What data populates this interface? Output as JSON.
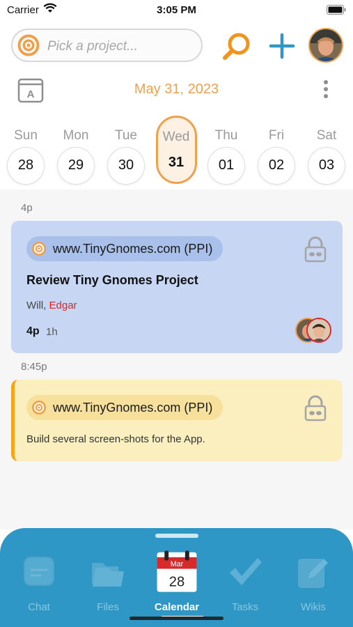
{
  "status_bar": {
    "carrier": "Carrier",
    "time": "3:05 PM"
  },
  "header": {
    "project_placeholder": "Pick a project...",
    "current_date": "May 31, 2023",
    "calendar_format_icon_letter": "A"
  },
  "week": [
    {
      "day": "Sun",
      "date": "28",
      "selected": false
    },
    {
      "day": "Mon",
      "date": "29",
      "selected": false
    },
    {
      "day": "Tue",
      "date": "30",
      "selected": false
    },
    {
      "day": "Wed",
      "date": "31",
      "selected": true
    },
    {
      "day": "Thu",
      "date": "01",
      "selected": false
    },
    {
      "day": "Fri",
      "date": "02",
      "selected": false
    },
    {
      "day": "Sat",
      "date": "03",
      "selected": false
    }
  ],
  "schedule": {
    "groups": [
      {
        "time": "4p",
        "event": {
          "project": "www.TinyGnomes.com (PPI)",
          "title": "Review Tiny Gnomes Project",
          "attendee_first": "Will,",
          "attendee_second": "Edgar",
          "start": "4p",
          "duration": "1h",
          "color": "#c6d6f3"
        }
      },
      {
        "time": "8:45p",
        "event": {
          "project": "www.TinyGnomes.com (PPI)",
          "note": "Build several screen-shots for the App.",
          "color": "#fbefbf"
        }
      }
    ]
  },
  "tabs": [
    {
      "label": "Chat",
      "icon": "chat-icon",
      "active": false
    },
    {
      "label": "Files",
      "icon": "folder-icon",
      "active": false
    },
    {
      "label": "Calendar",
      "icon": "calendar-icon",
      "active": true,
      "calendar_month": "Mar",
      "calendar_day": "28"
    },
    {
      "label": "Tasks",
      "icon": "checkmark-icon",
      "active": false
    },
    {
      "label": "Wikis",
      "icon": "edit-icon",
      "active": false
    }
  ],
  "colors": {
    "accent": "#f0a04b",
    "search": "#f2941b",
    "add": "#2f97c6",
    "tab_bar": "#2f97c6",
    "attendee_highlight": "#e02424"
  }
}
